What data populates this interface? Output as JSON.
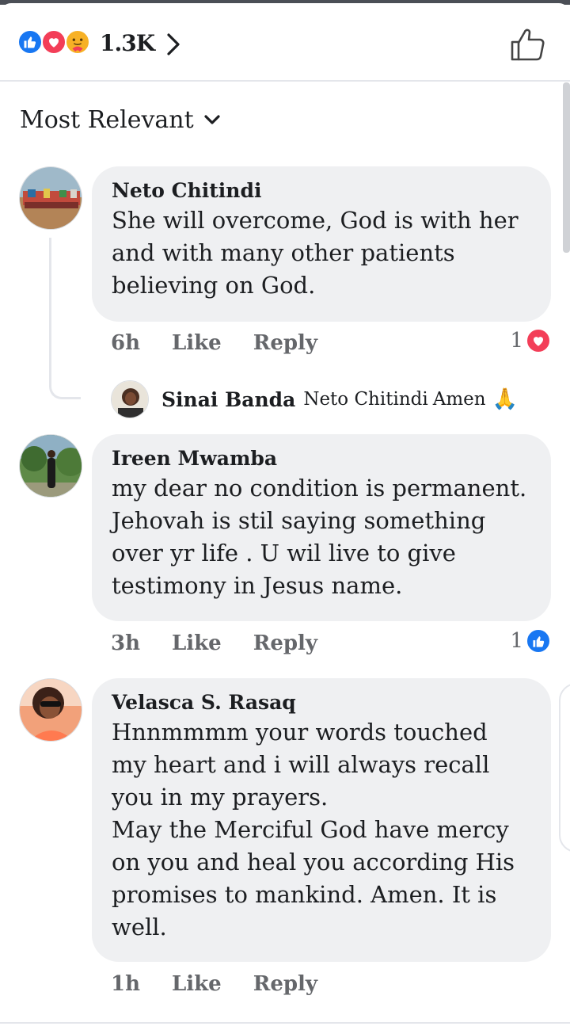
{
  "header": {
    "reaction_count": "1.3K",
    "reaction_icons": [
      "like-reaction-icon",
      "love-reaction-icon",
      "care-reaction-icon"
    ],
    "like_button_icon": "thumbs-up-outline-icon"
  },
  "sort": {
    "label": "Most Relevant",
    "icon": "chevron-down-icon"
  },
  "comments": [
    {
      "author": "Neto Chitindi",
      "text": "She will overcome, God is with her\nand with many other patients\nbelieving on God.",
      "time": "6h",
      "like_label": "Like",
      "reply_label": "Reply",
      "reaction_count": "1",
      "reaction_type": "love"
    },
    {
      "author": "Ireen Mwamba",
      "text": "my dear no condition is permanent.\nJehovah is stil saying something\nover yr life . U wil live to give\ntestimony in Jesus name.",
      "time": "3h",
      "like_label": "Like",
      "reply_label": "Reply",
      "reaction_count": "1",
      "reaction_type": "like"
    },
    {
      "author": "Velasca S. Rasaq",
      "text": "Hnnmmmm your words touched\nmy heart and i will always recall\nyou in my prayers.\nMay the Merciful God have mercy\non you and heal you according His\npromises to mankind. Amen. It is\nwell.",
      "time": "1h",
      "like_label": "Like",
      "reply_label": "Reply"
    }
  ],
  "reply_preview": {
    "author": "Sinai Banda",
    "mention": "Neto Chitindi",
    "text": "Amen",
    "emoji": "🙏"
  },
  "colors": {
    "like_blue": "#1877f2",
    "love_red": "#f33e58",
    "care_yellow": "#f7b125",
    "bubble_bg": "#eff0f2",
    "secondary_text": "#65676b"
  }
}
